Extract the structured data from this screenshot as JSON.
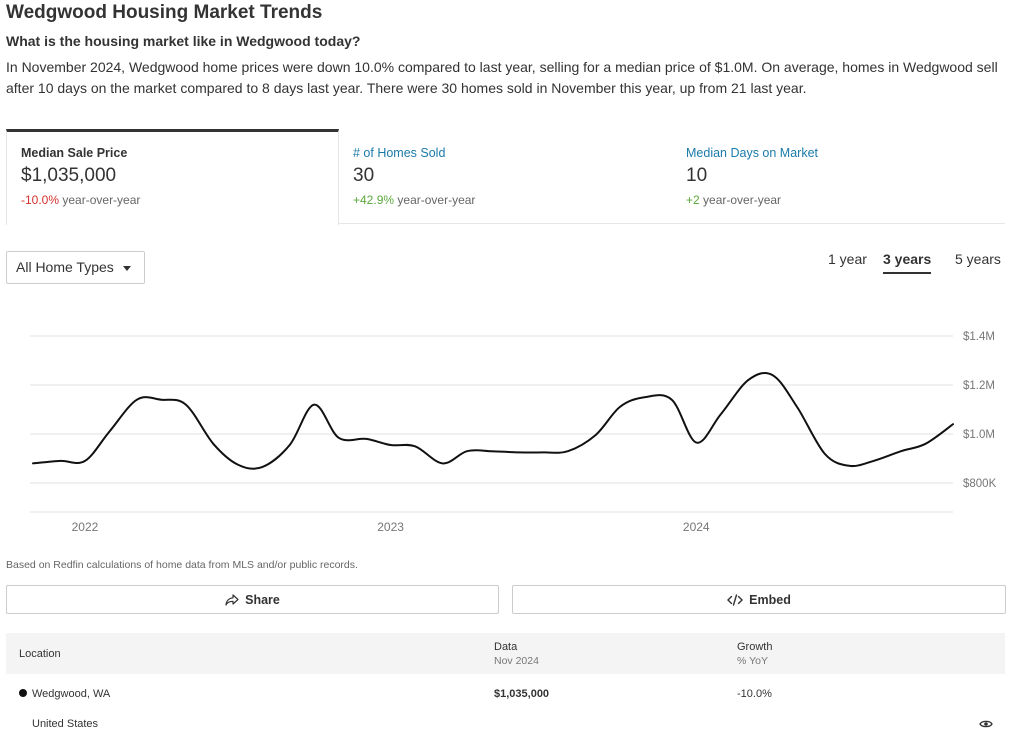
{
  "header": {
    "title": "Wedgwood Housing Market Trends",
    "subtitle": "What is the housing market like in Wedgwood today?",
    "summary": "In November 2024, Wedgwood home prices were down 10.0% compared to last year, selling for a median price of $1.0M. On average, homes in Wedgwood sell after 10 days on the market compared to 8 days last year. There were 30 homes sold in November this year, up from 21 last year."
  },
  "tabs": [
    {
      "label": "Median Sale Price",
      "value": "$1,035,000",
      "change": "-10.0%",
      "change_suffix": "year-over-year",
      "direction": "negative",
      "active": true
    },
    {
      "label": "# of Homes Sold",
      "value": "30",
      "change": "+42.9%",
      "change_suffix": "year-over-year",
      "direction": "positive",
      "active": false
    },
    {
      "label": "Median Days on Market",
      "value": "10",
      "change": "+2",
      "change_suffix": "year-over-year",
      "direction": "positive",
      "active": false
    }
  ],
  "filters": {
    "home_type": "All Home Types",
    "ranges": [
      {
        "label": "1 year",
        "active": false
      },
      {
        "label": "3 years",
        "active": true
      },
      {
        "label": "5 years",
        "active": false
      }
    ]
  },
  "chart_data": {
    "type": "line",
    "title": "",
    "xlabel": "",
    "ylabel": "",
    "x_ticks": [
      {
        "label": "2022",
        "year": 2022.0
      },
      {
        "label": "2023",
        "year": 2023.0
      },
      {
        "label": "2024",
        "year": 2024.0
      }
    ],
    "y_ticks": [
      {
        "label": "$800K",
        "value": 800000
      },
      {
        "label": "$1.0M",
        "value": 1000000
      },
      {
        "label": "$1.2M",
        "value": 1200000
      },
      {
        "label": "$1.4M",
        "value": 1400000
      }
    ],
    "ylim": [
      800000,
      1400000
    ],
    "xlim": [
      2021.83,
      2024.84
    ],
    "grid": true,
    "line_color": "#111111",
    "series": [
      {
        "x": [
          2021.83,
          2021.92,
          2022.0,
          2022.08,
          2022.17,
          2022.25,
          2022.33,
          2022.42,
          2022.5,
          2022.58,
          2022.67,
          2022.75,
          2022.83,
          2022.92,
          2023.0,
          2023.08,
          2023.17,
          2023.25,
          2023.33,
          2023.42,
          2023.5,
          2023.58,
          2023.67,
          2023.75,
          2023.83,
          2023.92,
          2024.0,
          2024.08,
          2024.17,
          2024.25,
          2024.33,
          2024.42,
          2024.5,
          2024.58,
          2024.67,
          2024.75,
          2024.84
        ],
        "y": [
          880000,
          890000,
          890000,
          1010000,
          1140000,
          1140000,
          1120000,
          960000,
          875000,
          865000,
          955000,
          1120000,
          985000,
          980000,
          955000,
          950000,
          880000,
          930000,
          930000,
          925000,
          925000,
          930000,
          995000,
          1110000,
          1150000,
          1140000,
          965000,
          1080000,
          1220000,
          1240000,
          1110000,
          920000,
          870000,
          890000,
          930000,
          960000,
          1040000
        ]
      }
    ]
  },
  "footnote": "Based on Redfin calculations of home data from MLS and/or public records.",
  "actions": {
    "share": "Share",
    "embed": "Embed"
  },
  "table": {
    "headers": {
      "location": "Location",
      "data": "Data",
      "data_sub": "Nov 2024",
      "growth": "Growth",
      "growth_sub": "% YoY"
    },
    "rows": [
      {
        "location": "Wedgwood, WA",
        "data": "$1,035,000",
        "growth": "-10.0%"
      },
      {
        "location": "United States",
        "data": "",
        "growth": ""
      }
    ]
  }
}
